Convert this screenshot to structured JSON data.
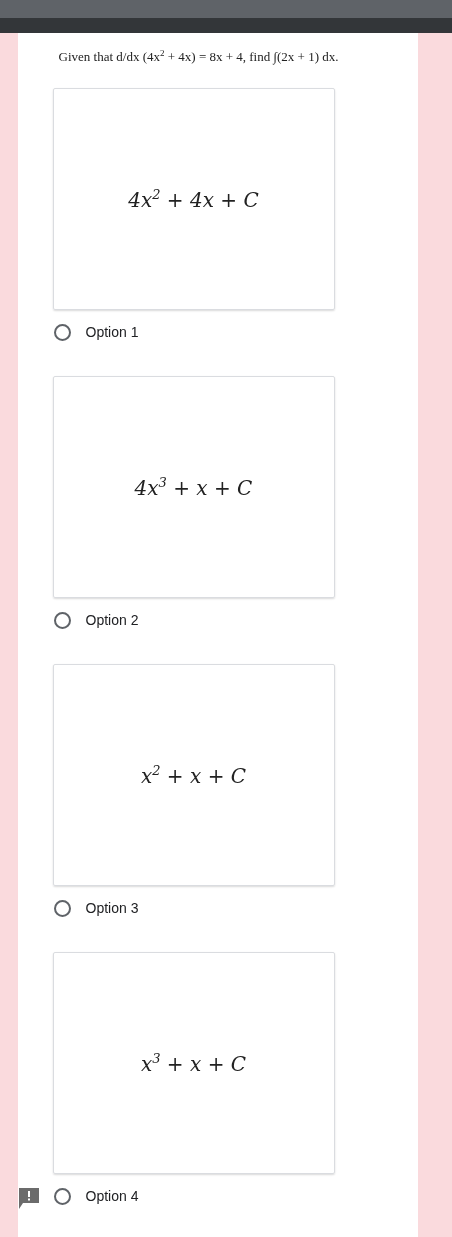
{
  "question": "Given that d/dx (4x$^{2}$ + 4x) = 8x + 4, find ∫(2x + 1) dx.",
  "options": [
    {
      "image_math": "4x$^{2}$ + 4x + C",
      "label": "Option 1",
      "selected": false
    },
    {
      "image_math": "4x$^{3}$ + x + C",
      "label": "Option 2",
      "selected": false
    },
    {
      "image_math": "x$^{2}$ + x + C",
      "label": "Option 3",
      "selected": false
    },
    {
      "image_math": "x$^{3}$ + x + C",
      "label": "Option 4",
      "selected": false
    }
  ]
}
